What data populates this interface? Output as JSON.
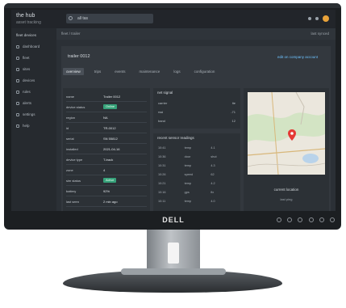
{
  "monitor": {
    "brand_logo": "DELL"
  },
  "app": {
    "brand_name": "the hub",
    "brand_sub": "asset tracking",
    "search_value": "all tas"
  },
  "sidebar": {
    "header": "fleet devices",
    "items": [
      {
        "label": "dashboard"
      },
      {
        "label": "fleet"
      },
      {
        "label": "sites"
      },
      {
        "label": "devices"
      },
      {
        "label": "rules"
      },
      {
        "label": "alerts"
      },
      {
        "label": "settings"
      },
      {
        "label": "help"
      }
    ]
  },
  "breadcrumb": {
    "text": "fleet / trailer",
    "right": "last synced"
  },
  "panel": {
    "title": "trailer 0012",
    "link": "edit on company account",
    "tabs": [
      {
        "label": "overview"
      },
      {
        "label": "trips"
      },
      {
        "label": "events"
      },
      {
        "label": "maintenance"
      },
      {
        "label": "logs"
      },
      {
        "label": "configuration"
      }
    ]
  },
  "details": [
    {
      "key": "name",
      "value": "Trailer 0012"
    },
    {
      "key": "device status",
      "value": "Online",
      "pill": true
    },
    {
      "key": "region",
      "value": "NA"
    },
    {
      "key": "id",
      "value": "TR-0012"
    },
    {
      "key": "serial",
      "value": "SN 55812"
    },
    {
      "key": "installed",
      "value": "2021-04-16"
    },
    {
      "key": "device type",
      "value": "T-track"
    },
    {
      "key": "zone",
      "value": "4"
    },
    {
      "key": "sim status",
      "value": "Active",
      "pill": true
    },
    {
      "key": "battery",
      "value": "92%"
    },
    {
      "key": "last seen",
      "value": "2 min ago"
    }
  ],
  "network": {
    "title": "net signal",
    "rows": [
      {
        "k": "carrier",
        "v": "lte"
      },
      {
        "k": "rssi",
        "v": "-71"
      },
      {
        "k": "band",
        "v": "12"
      }
    ]
  },
  "readings": {
    "title": "recent sensor readings",
    "rows": [
      [
        "10:41",
        "temp",
        "4.1"
      ],
      [
        "10:36",
        "door",
        "shut"
      ],
      [
        "10:31",
        "temp",
        "4.3"
      ],
      [
        "10:26",
        "speed",
        "62"
      ],
      [
        "10:21",
        "temp",
        "4.2"
      ],
      [
        "10:16",
        "gps",
        "fix"
      ],
      [
        "10:11",
        "temp",
        "4.0"
      ]
    ]
  },
  "map": {
    "label": "current location",
    "sub": "last ping"
  },
  "colors": {
    "accent": "#6ec3ff",
    "status_ok": "#36a27a",
    "marker": "#e53935"
  }
}
